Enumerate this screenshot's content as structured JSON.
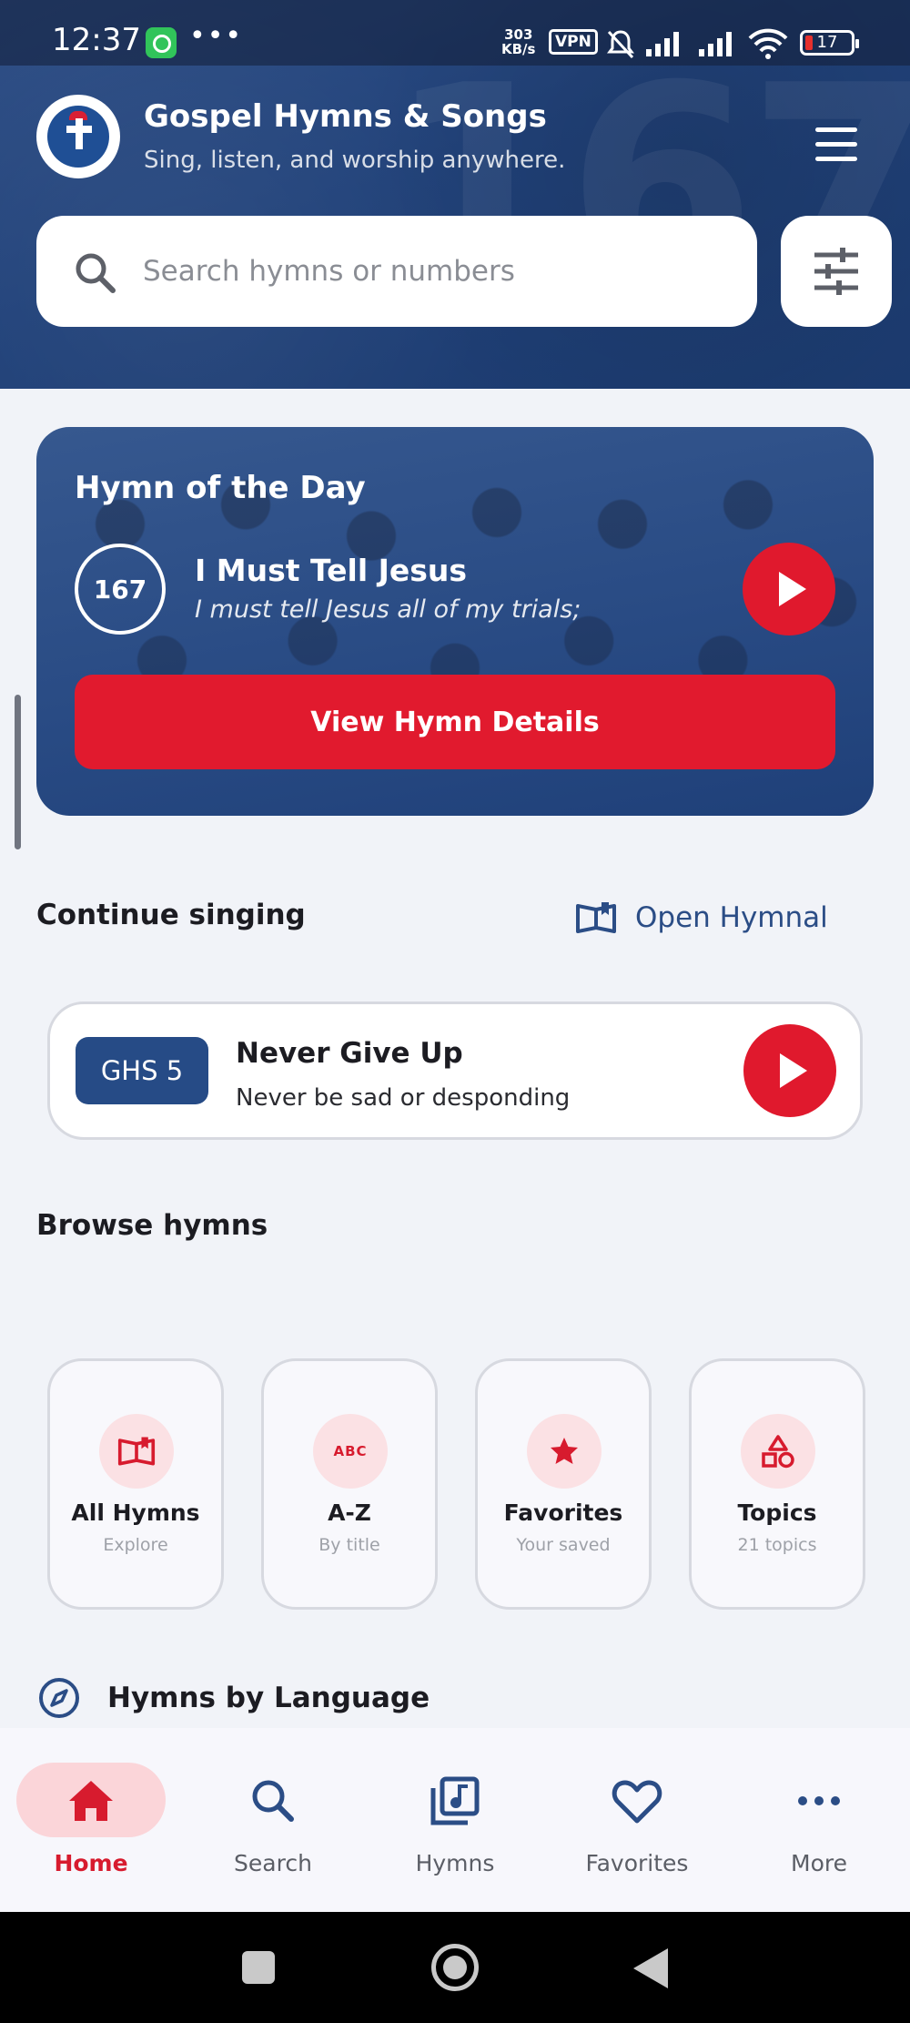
{
  "status_bar": {
    "time": "12:37",
    "more": "•••",
    "speed_value": "303",
    "speed_unit": "KB/s",
    "vpn": "VPN",
    "battery": "17"
  },
  "app": {
    "title": "Gospel Hymns & Songs",
    "subtitle": "Sing, listen, and worship anywhere.",
    "background_number": "167"
  },
  "search": {
    "placeholder": "Search hymns or numbers",
    "value": ""
  },
  "hymn_of_day": {
    "label": "Hymn of the Day",
    "number": "167",
    "title": "I Must Tell Jesus",
    "first_line": "I must tell Jesus all of my trials;",
    "details_button": "View Hymn Details"
  },
  "continue": {
    "heading": "Continue singing",
    "open_hymnal": "Open Hymnal",
    "item": {
      "code": "GHS 5",
      "title": "Never Give Up",
      "first_line": "Never be sad or desponding"
    }
  },
  "browse": {
    "heading": "Browse hymns",
    "tiles": [
      {
        "title": "All Hymns",
        "subtitle": "Explore",
        "icon": "open-book-icon"
      },
      {
        "title": "A-Z",
        "subtitle": "By title",
        "icon": "abc-icon"
      },
      {
        "title": "Favorites",
        "subtitle": "Your saved",
        "icon": "star-icon"
      },
      {
        "title": "Topics",
        "subtitle": "21 topics",
        "icon": "shapes-icon"
      }
    ]
  },
  "language": {
    "heading": "Hymns by Language"
  },
  "bottom_nav": {
    "items": [
      {
        "label": "Home",
        "icon": "home-icon",
        "active": true
      },
      {
        "label": "Search",
        "icon": "search-icon",
        "active": false
      },
      {
        "label": "Hymns",
        "icon": "music-library-icon",
        "active": false
      },
      {
        "label": "Favorites",
        "icon": "heart-icon",
        "active": false
      },
      {
        "label": "More",
        "icon": "more-dots-icon",
        "active": false
      }
    ]
  },
  "colors": {
    "brand_blue": "#264b86",
    "accent_red": "#e0192d",
    "active_pill": "#fbd5d9",
    "background": "#f1f3f8"
  },
  "abc_glyph": "ABC"
}
